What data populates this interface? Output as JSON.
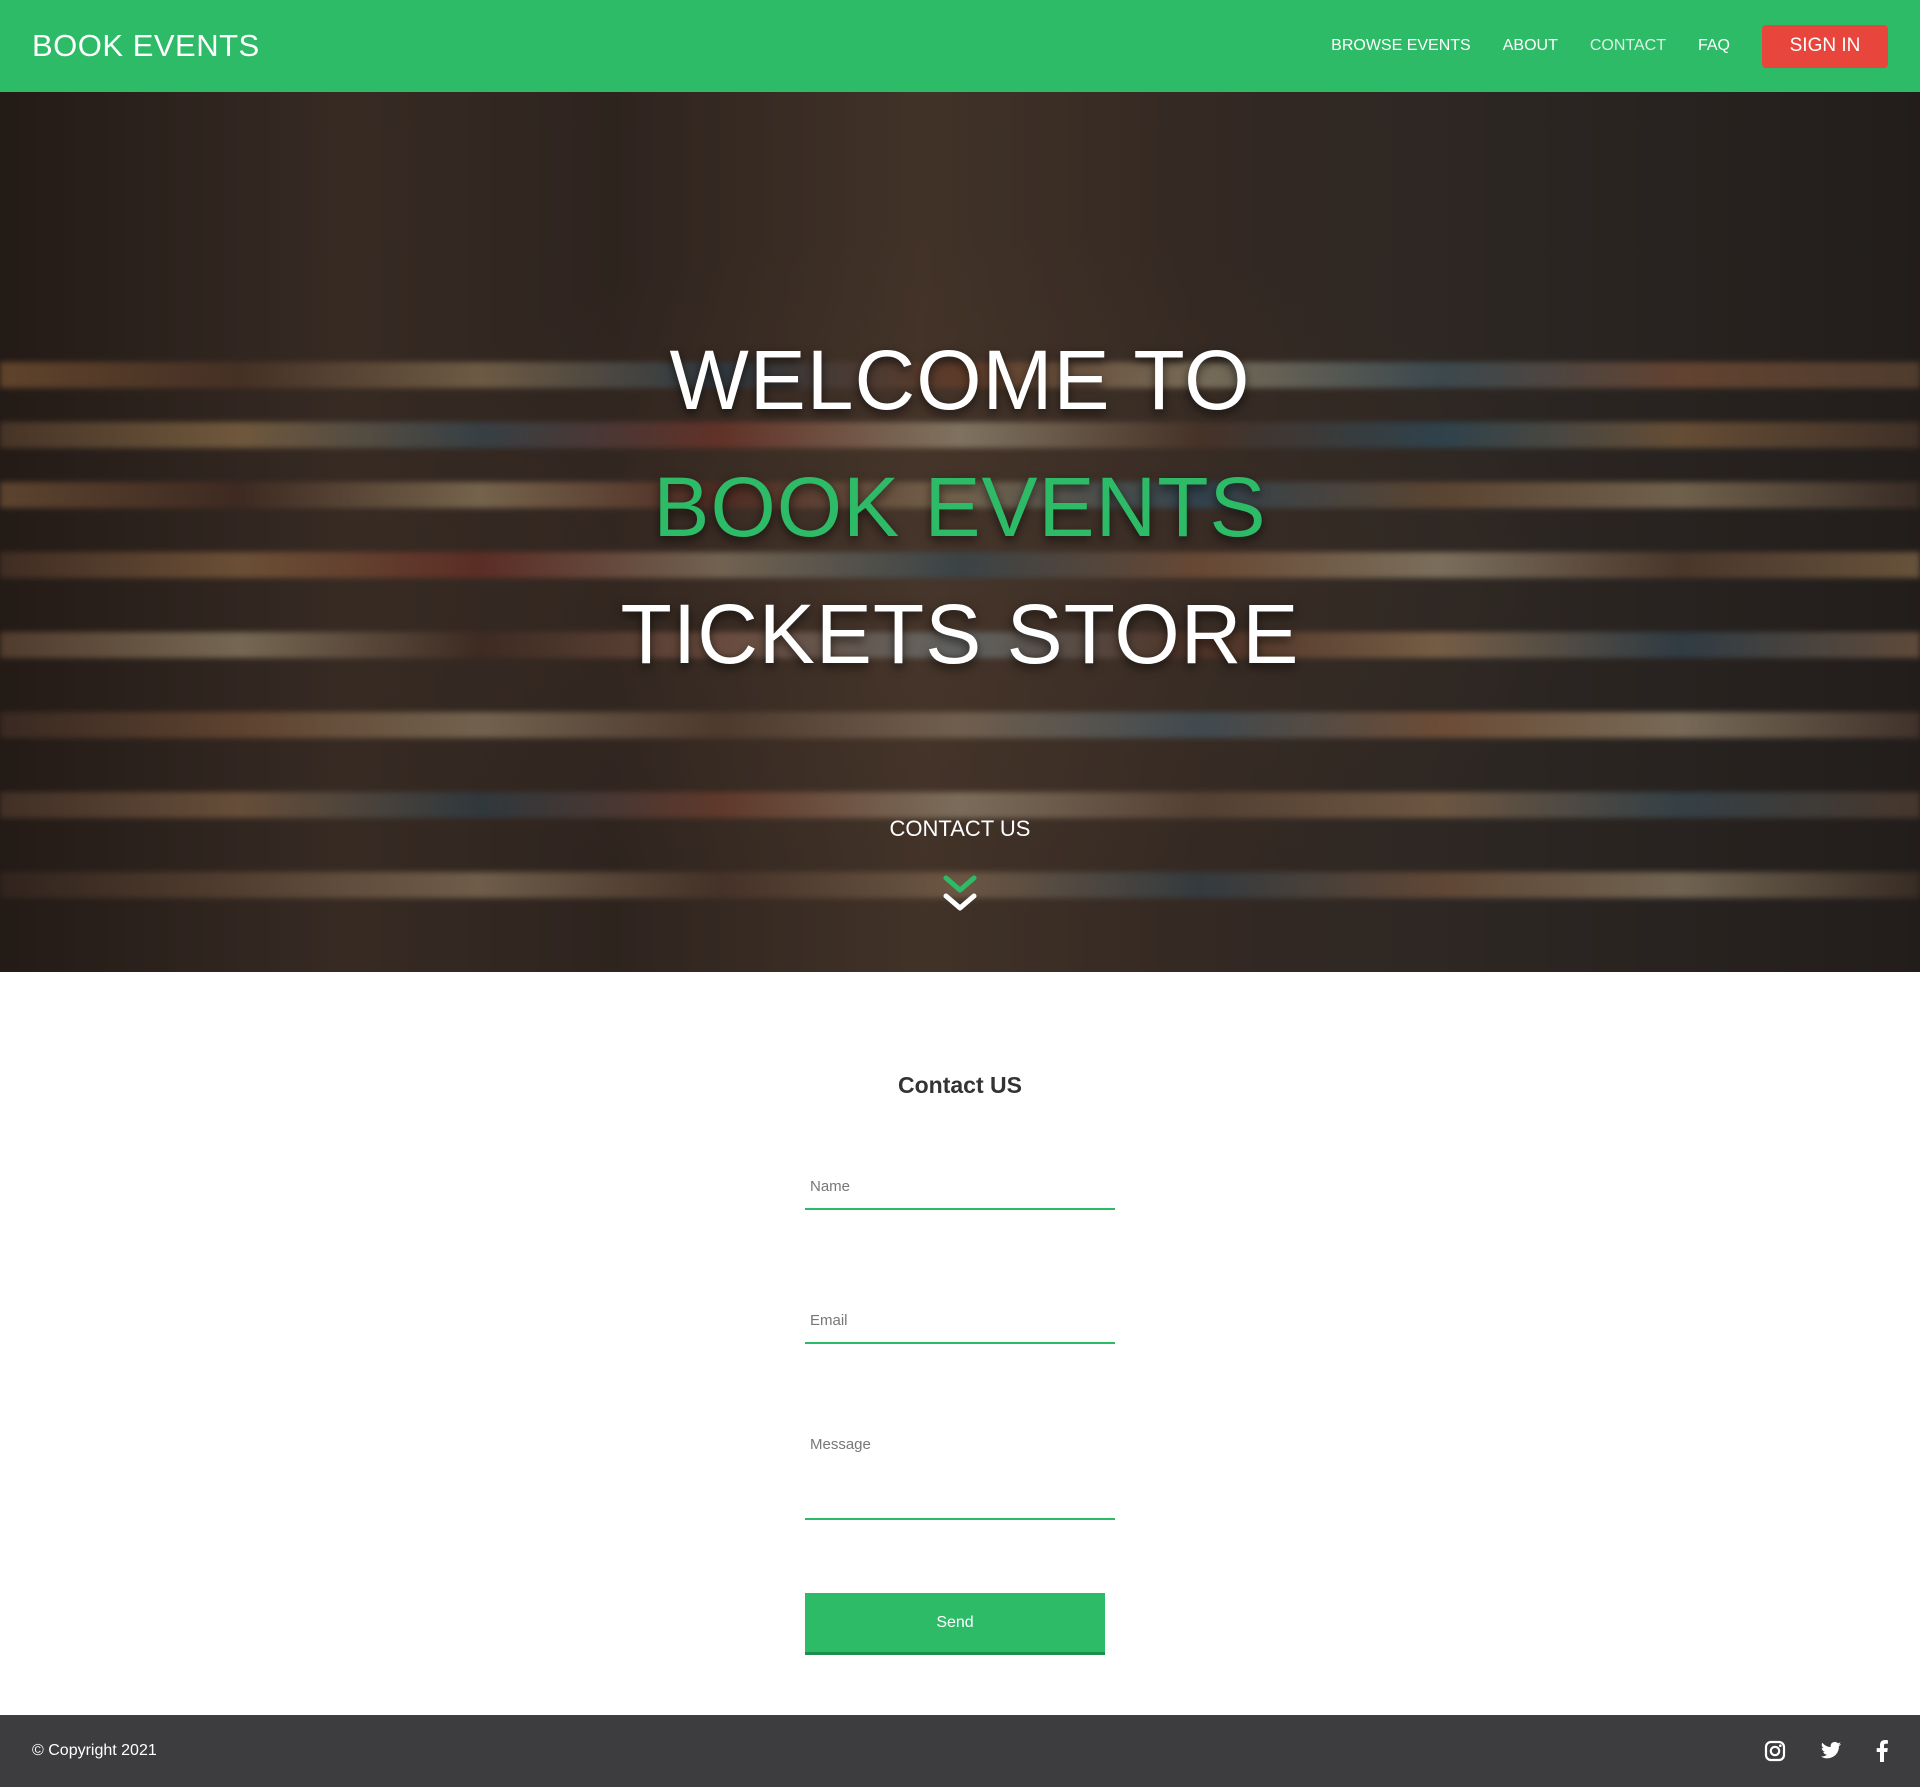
{
  "nav": {
    "brand": "BOOK EVENTS",
    "links": [
      "BROWSE EVENTS",
      "ABOUT",
      "CONTACT",
      "FAQ"
    ],
    "active": "CONTACT",
    "signin_label": "SIGN IN"
  },
  "hero": {
    "line1": "WELCOME TO",
    "line2": "BOOK EVENTS",
    "line3": "TICKETS STORE",
    "cta": "CONTACT US"
  },
  "contact": {
    "title": "Contact US",
    "name_placeholder": "Name",
    "email_placeholder": "Email",
    "message_placeholder": "Message",
    "send_label": "Send"
  },
  "footer": {
    "copyright": "© Copyright 2021",
    "social_icons": [
      "instagram-icon",
      "twitter-icon",
      "facebook-icon"
    ]
  },
  "colors": {
    "accent": "#2dbb67",
    "signin": "#e8463d",
    "footer": "#3d3d3f"
  }
}
